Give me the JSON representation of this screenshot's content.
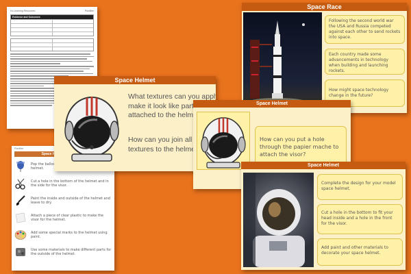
{
  "document": {
    "header_left": "Ks Learning Resources",
    "header_right": "PlanBee",
    "title": "Evidence and Outcomes"
  },
  "space_race": {
    "title": "Space Race",
    "boxes": [
      "Following the second world war the USA and Russia competed against each other to send rockets into space.",
      "Each country made some advancements in technology when building and launching rockets.",
      "How might space technology change in the future?"
    ]
  },
  "instructions": {
    "header": "PlanBee",
    "title": "Space Helmet Instructions",
    "steps": [
      {
        "icon": "balloon-icon",
        "text": "Pop the balloon inside your papier mache helmet."
      },
      {
        "icon": "scissors-icon",
        "text": "Cut a hole in the bottom of the helmet and in the side for the visor."
      },
      {
        "icon": "paintbrush-icon",
        "text": "Paint the inside and outside of the helmet and leave to dry."
      },
      {
        "icon": "plastic-icon",
        "text": "Attach a piece of clear plastic to make the visor for the helmet."
      },
      {
        "icon": "palette-icon",
        "text": "Add some special marks to the helmet using paint."
      },
      {
        "icon": "materials-icon",
        "text": "Use some materials to make different parts for the outside of the helmet."
      }
    ]
  },
  "helmet_slide_1": {
    "title": "Space Helmet",
    "question_1": "What textures can you apply to make it look like parts have been attached to the helmet?",
    "question_2": "How can you join all of the different textures to the helmet?"
  },
  "helmet_slide_2": {
    "title": "Space Helmet",
    "question": "How can you put a hole through the papier mache to attach the visor?"
  },
  "helmet_slide_3": {
    "title": "Space Helmet",
    "boxes": [
      "Complete the design for your model space helmet.",
      "Cut a hole in the bottom to fit your head inside and a hole in the front for the visor.",
      "Add paint and other materials to decorate your space helmet."
    ]
  },
  "colors": {
    "background": "#e9721c",
    "title_bar": "#c55a11",
    "slide_bg": "#fbf0c8",
    "text_box": "#fff2a8"
  }
}
